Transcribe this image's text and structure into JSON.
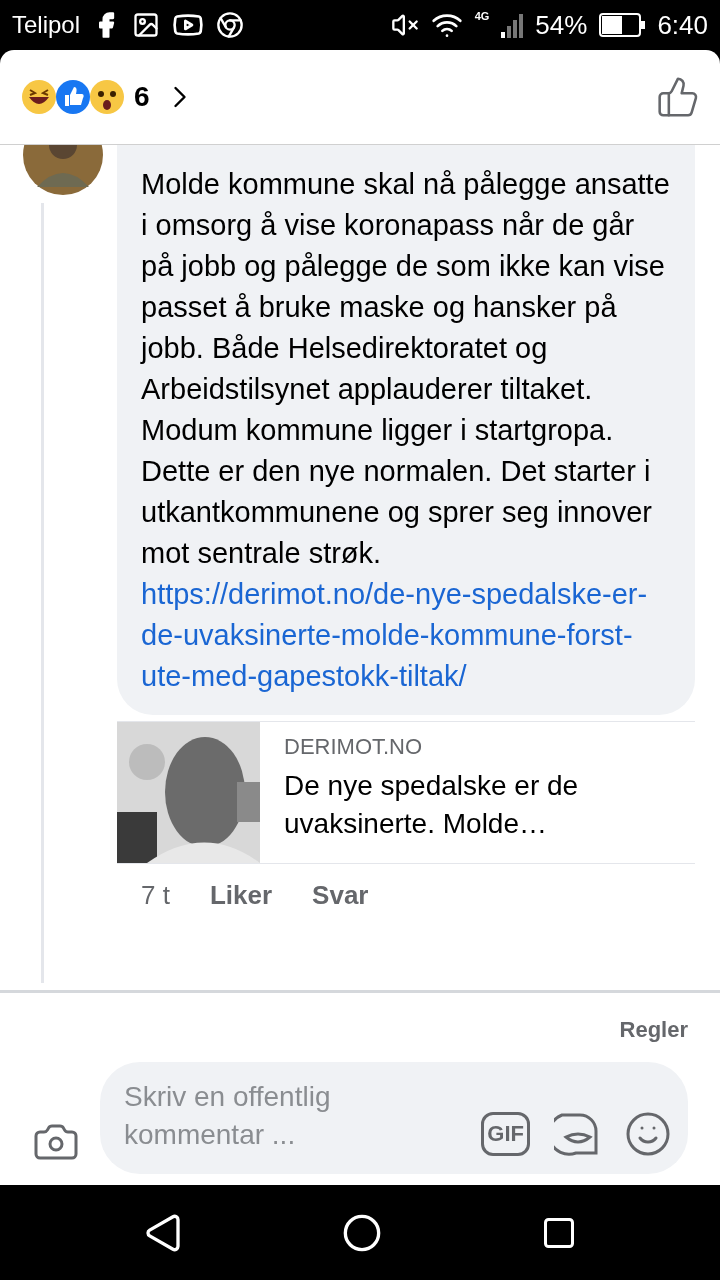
{
  "status_bar": {
    "carrier": "Telipol",
    "network": "4G",
    "battery": "54%",
    "time": "6:40"
  },
  "header": {
    "reaction_count": "6"
  },
  "comment": {
    "text": "Molde kommune skal nå pålegge ansatte i omsorg å vise koronapass når de går på jobb og pålegge de som ikke kan vise passet å bruke maske og hansker på jobb. Både Helsedirektoratet og Arbeidstilsynet applauderer tiltaket. Modum kommune ligger i startgropa. Dette er den nye normalen. Det starter i utkantkommunene og sprer seg innover mot sentrale strøk.",
    "link": "https://derimot.no/de-nye-spedalske-er-de-uvaksinerte-molde-kommune-forst-ute-med-gapestokk-tiltak/",
    "preview": {
      "domain": "DERIMOT.NO",
      "title": "De nye spedalske er de uvaksinerte. Molde…"
    },
    "time": "7 t",
    "actions": [
      "Liker",
      "Svar"
    ]
  },
  "footer": {
    "rules": "Regler",
    "placeholder": "Skriv en offentlig kommentar ...",
    "gif_label": "GIF"
  }
}
